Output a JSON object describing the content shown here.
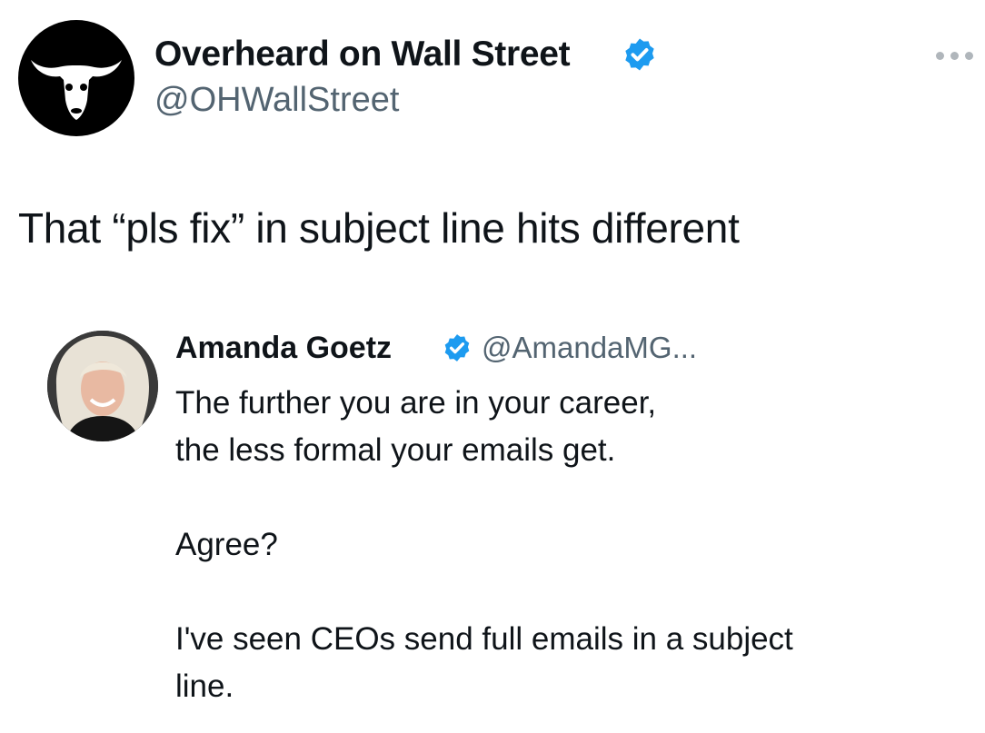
{
  "tweet": {
    "author": {
      "display_name": "Overheard on Wall Street",
      "handle": "@OHWallStreet",
      "verified": true,
      "avatar_icon": "bull-skull-icon"
    },
    "text": "That “pls fix” in subject line hits different",
    "more_icon": "more-dots-icon"
  },
  "quoted_tweet": {
    "author": {
      "display_name": "Amanda Goetz",
      "handle": "@AmandaMG...",
      "verified": true
    },
    "paragraphs": [
      [
        "The further you are in your career,",
        "the less formal your emails get."
      ],
      [
        "Agree?"
      ],
      [
        "I've seen CEOs send full emails in a subject",
        "line."
      ]
    ]
  },
  "colors": {
    "text": "#0f1419",
    "secondary_text": "#536471",
    "verified_badge": "#1d9bf0",
    "avatar_bg": "#000000"
  }
}
